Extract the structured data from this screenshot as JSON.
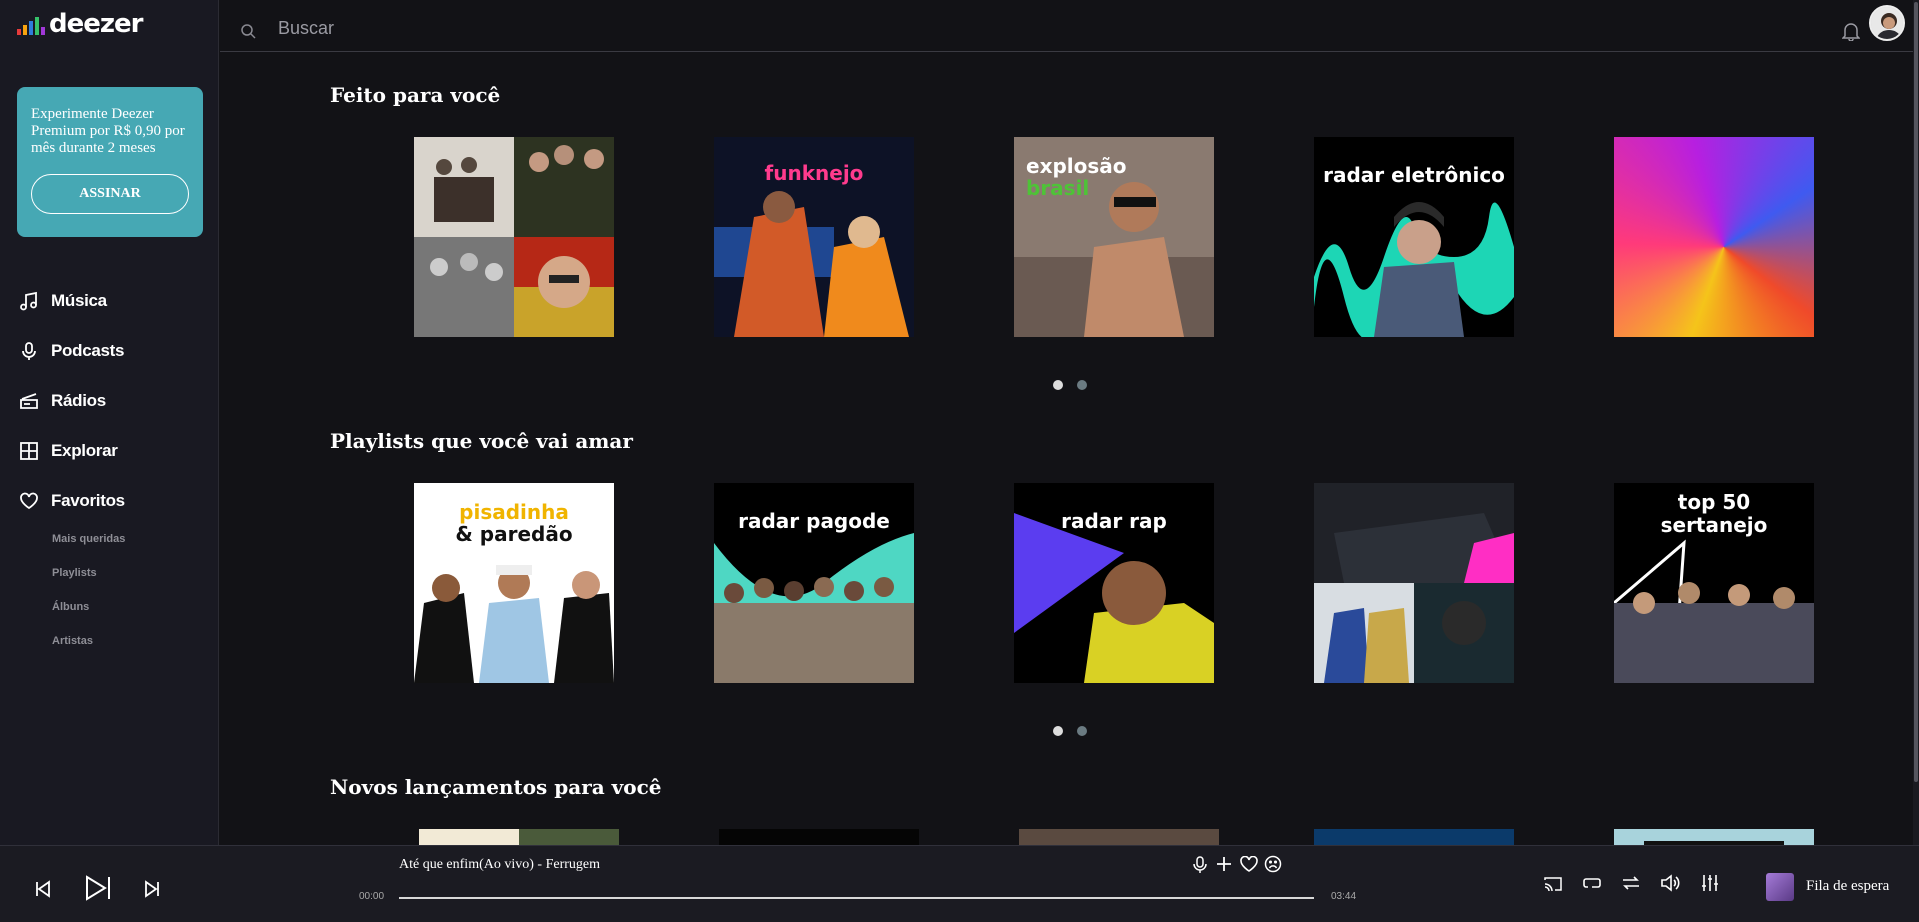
{
  "app": {
    "logo_text": "deezer"
  },
  "search": {
    "placeholder": "Buscar"
  },
  "promo": {
    "text": "Experimente Deezer Premium por R$ 0,90 por mês durante 2 meses",
    "button": "ASSINAR"
  },
  "nav": {
    "items": [
      {
        "label": "Música",
        "icon": "music-note-icon"
      },
      {
        "label": "Podcasts",
        "icon": "microphone-icon"
      },
      {
        "label": "Rádios",
        "icon": "radio-icon"
      },
      {
        "label": "Explorar",
        "icon": "grid-icon"
      },
      {
        "label": "Favoritos",
        "icon": "heart-icon"
      }
    ],
    "sub_items": [
      "Mais queridas",
      "Playlists",
      "Álbuns",
      "Artistas"
    ]
  },
  "sections": [
    {
      "title": "Feito para você",
      "cards": [
        {
          "label": ""
        },
        {
          "label": "funknejo"
        },
        {
          "label": "explosão",
          "label2": "brasil"
        },
        {
          "label": "radar eletrônico"
        },
        {
          "label": ""
        }
      ]
    },
    {
      "title": "Playlists que você vai amar",
      "cards": [
        {
          "label": "pisadinha",
          "label2": "& paredão"
        },
        {
          "label": "radar pagode"
        },
        {
          "label": "radar rap"
        },
        {
          "label": ""
        },
        {
          "label": "top 50",
          "label2": "sertanejo"
        }
      ]
    },
    {
      "title": "Novos lançamentos para você"
    }
  ],
  "player": {
    "track": "Até que enfim(Ao vivo) - Ferrugem",
    "elapsed": "00:00",
    "duration": "03:44",
    "progress": 0,
    "queue_label": "Fila de espera"
  },
  "colors": {
    "background": "#121216",
    "sidebar": "#191922",
    "promo": "#46a8b4",
    "funknejo": "#ff3b8d",
    "brasil_green": "#4ec337"
  }
}
